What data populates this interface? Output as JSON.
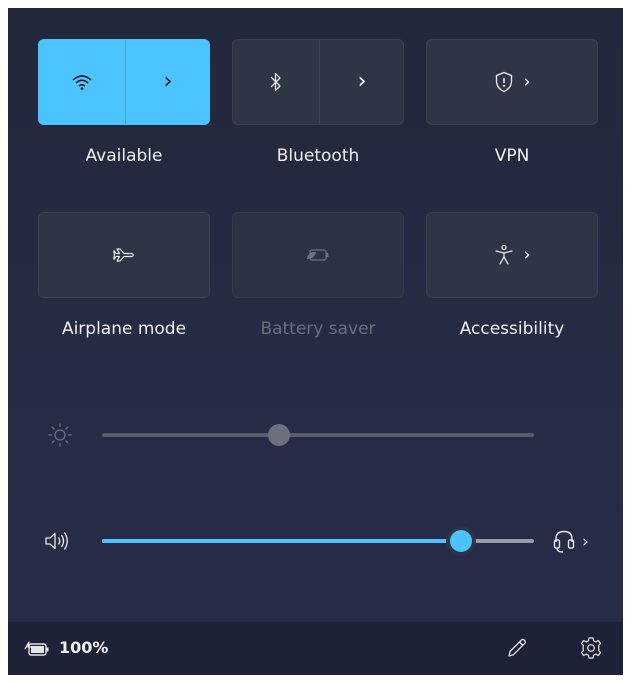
{
  "tiles": [
    {
      "id": "wifi",
      "label": "Available",
      "state": "on",
      "icon": "wifi-icon",
      "has_chevron": true
    },
    {
      "id": "bluetooth",
      "label": "Bluetooth",
      "state": "off",
      "icon": "bluetooth-icon",
      "has_chevron": true
    },
    {
      "id": "vpn",
      "label": "VPN",
      "state": "off",
      "icon": "shield-icon",
      "has_chevron": true
    },
    {
      "id": "airplane",
      "label": "Airplane mode",
      "state": "off",
      "icon": "airplane-icon",
      "has_chevron": false
    },
    {
      "id": "battery_saver",
      "label": "Battery saver",
      "state": "disabled",
      "icon": "battery-saver-icon",
      "has_chevron": false
    },
    {
      "id": "accessibility",
      "label": "Accessibility",
      "state": "off",
      "icon": "accessibility-icon",
      "has_chevron": true
    }
  ],
  "brightness": {
    "icon": "brightness-icon",
    "level": 0.41
  },
  "volume": {
    "icon": "speaker-icon",
    "level": 0.83,
    "output_icon": "headset-icon"
  },
  "footer": {
    "battery_icon": "battery-charging-icon",
    "battery_percent": "100%",
    "edit_icon": "pencil-icon",
    "settings_icon": "gear-icon"
  },
  "colors": {
    "accent": "#4cc2ff",
    "tile_off": "#303546",
    "panel": "#262b44"
  }
}
